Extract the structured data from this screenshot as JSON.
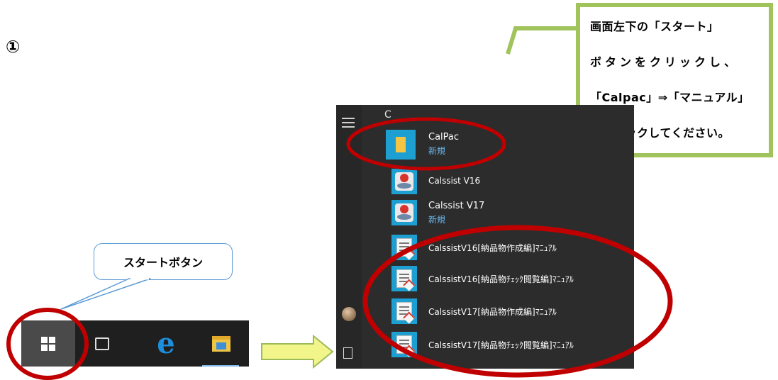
{
  "step_number": "①",
  "callout": {
    "line1": "画面左下の「スタート」",
    "line2": "ボタンをクリックし、",
    "line3": "「Calpac」⇒「マニュアル」",
    "line4": "をクリックしてください。"
  },
  "start_button_callout": "スタートボタン",
  "start_menu": {
    "section_letter": "C",
    "items": [
      {
        "name": "CalPac",
        "sub": "新規",
        "icon": "folder-icon"
      },
      {
        "name": "Calssist V16",
        "sub": "",
        "icon": "calssist-app-icon"
      },
      {
        "name": "Calssist V17",
        "sub": "新規",
        "icon": "calssist-app-icon"
      },
      {
        "name": "CalssistV16[納品物作成編]ﾏﾆｭｱﾙ",
        "sub": "",
        "icon": "manual-document-icon"
      },
      {
        "name": "CalssistV16[納品物ﾁｪｯｸ閲覧編]ﾏﾆｭｱﾙ",
        "sub": "",
        "icon": "manual-document-icon"
      },
      {
        "name": "CalssistV17[納品物作成編]ﾏﾆｭｱﾙ",
        "sub": "",
        "icon": "manual-document-icon"
      },
      {
        "name": "CalssistV17[納品物ﾁｪｯｸ閲覧編]ﾏﾆｭｱﾙ",
        "sub": "",
        "icon": "manual-document-icon"
      }
    ]
  },
  "taskbar": {
    "icons": [
      "windows-start-icon",
      "task-view-icon",
      "edge-browser-icon",
      "file-explorer-icon"
    ]
  },
  "colors": {
    "highlight_ellipse": "#c00000",
    "callout_border": "#a1c35c",
    "tile_blue": "#1d9fd1",
    "arrow_fill": "#f2f58a"
  }
}
